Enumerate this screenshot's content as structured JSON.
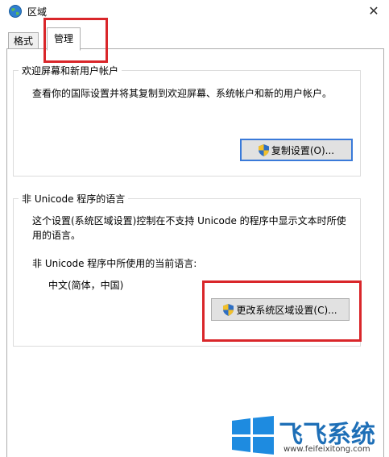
{
  "window": {
    "title": "区域",
    "close_glyph": "✕"
  },
  "tabs": [
    {
      "label": "格式"
    },
    {
      "label": "管理"
    }
  ],
  "welcome_group": {
    "title": "欢迎屏幕和新用户帐户",
    "description": "查看你的国际设置并将其复制到欢迎屏幕、系统帐户和新的用户帐户。",
    "copy_button": "复制设置(O)..."
  },
  "non_unicode_group": {
    "title": "非 Unicode 程序的语言",
    "description_line1": "这个设置(系统区域设置)控制在不支持 Unicode 的程序中显示文本时所使",
    "description_line2": "用的语言。",
    "current_label": "非 Unicode 程序中所使用的当前语言:",
    "current_value": "中文(简体，中国)",
    "change_button": "更改系统区域设置(C)..."
  },
  "watermark": {
    "brand": "飞飞系统",
    "url": "www.feifeixitong.com"
  },
  "colors": {
    "highlight": "#d9262a",
    "accent": "#3a7ad9",
    "brand": "#1e6fb7"
  }
}
